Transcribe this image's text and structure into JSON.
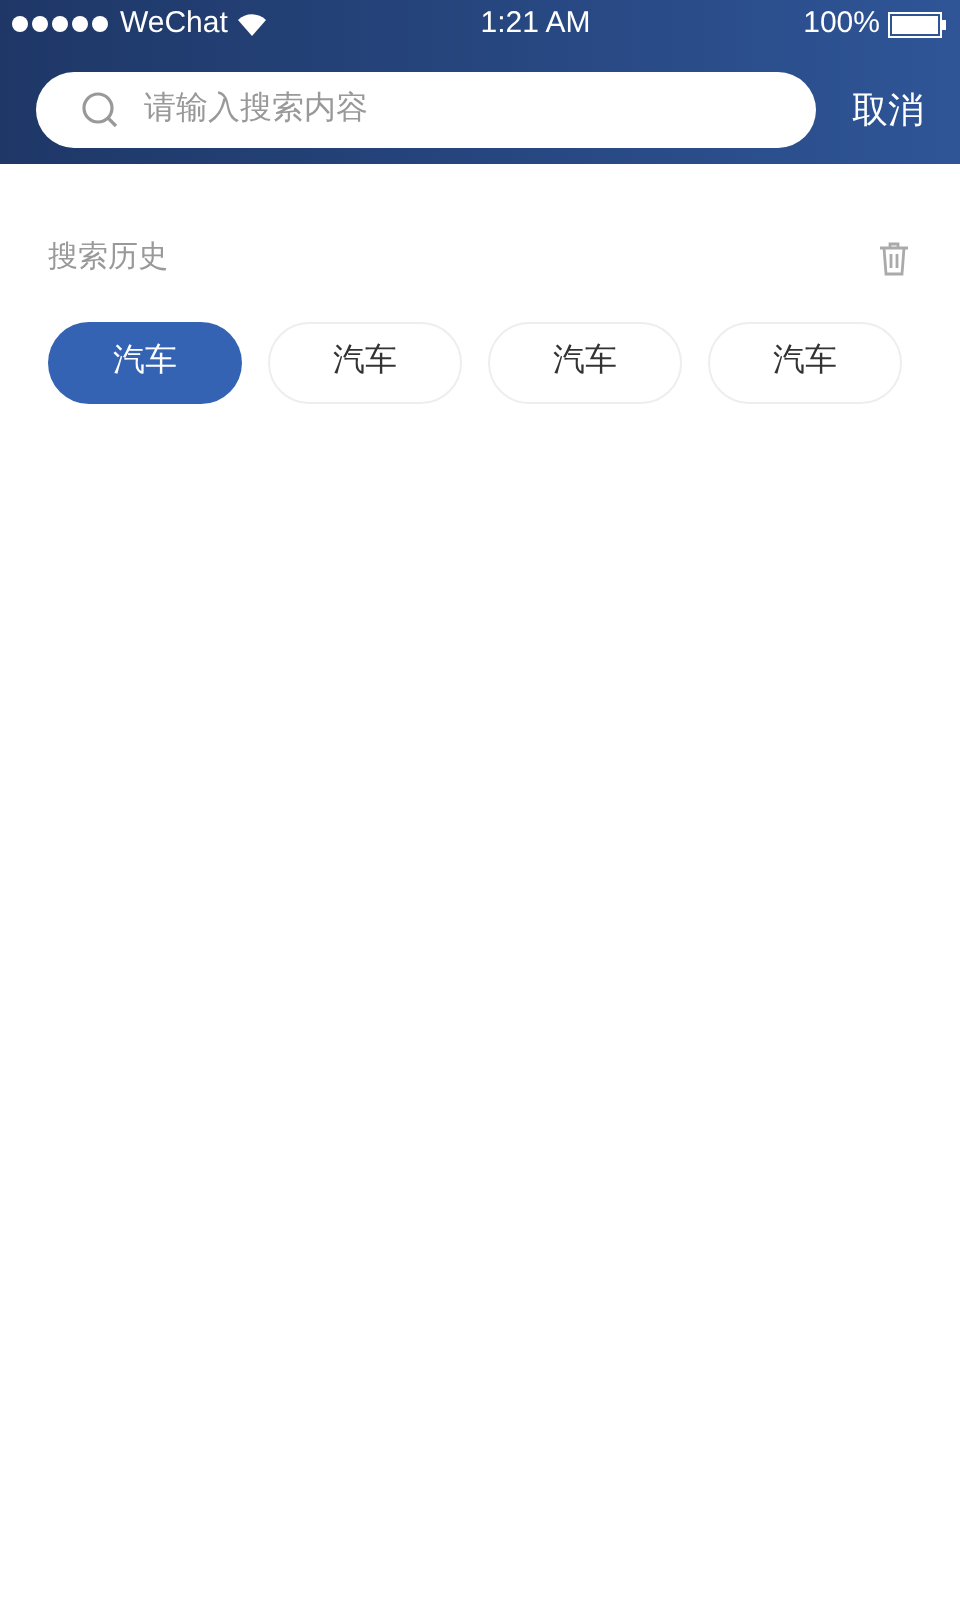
{
  "status_bar": {
    "carrier": "WeChat",
    "time": "1:21 AM",
    "battery": "100%"
  },
  "search": {
    "placeholder": "请输入搜索内容",
    "cancel": "取消"
  },
  "history": {
    "title": "搜索历史",
    "tags": [
      {
        "label": "汽车",
        "selected": true
      },
      {
        "label": "汽车",
        "selected": false
      },
      {
        "label": "汽车",
        "selected": false
      },
      {
        "label": "汽车",
        "selected": false
      }
    ]
  }
}
